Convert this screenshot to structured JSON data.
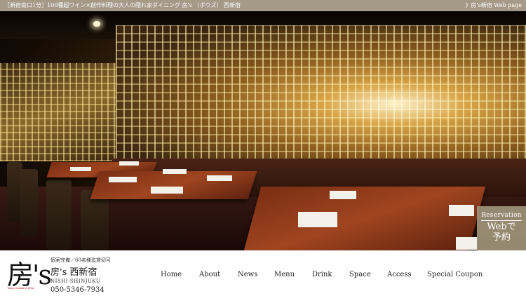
{
  "topbar": {
    "tagline": "［新宿南口1分］100種超ワイン×創作料理の大人の隠れ家ダイニング 房's （ボウズ） 西新宿",
    "web_link": "》房's新宿 Web page"
  },
  "reservation": {
    "line1": "Reservation",
    "line2": "Webで",
    "line3": "予約"
  },
  "shop": {
    "logo_text": "房's",
    "logo_sub": "Tokyo Cuisine & Wine",
    "note": "個室完備／60名様迄貸切可",
    "name": "房's 西新宿",
    "romaji": "NISHI-SHINJUKU",
    "tel": "050-5346-7934"
  },
  "nav": {
    "items": [
      {
        "label": "Home"
      },
      {
        "label": "About"
      },
      {
        "label": "News"
      },
      {
        "label": "Menu"
      },
      {
        "label": "Drink"
      },
      {
        "label": "Space"
      },
      {
        "label": "Access"
      },
      {
        "label": "Special Coupon"
      }
    ]
  },
  "colors": {
    "topbar_bg": "#a59a88",
    "reserve_bg": "#a0947a",
    "logo_sub": "#b21818"
  }
}
